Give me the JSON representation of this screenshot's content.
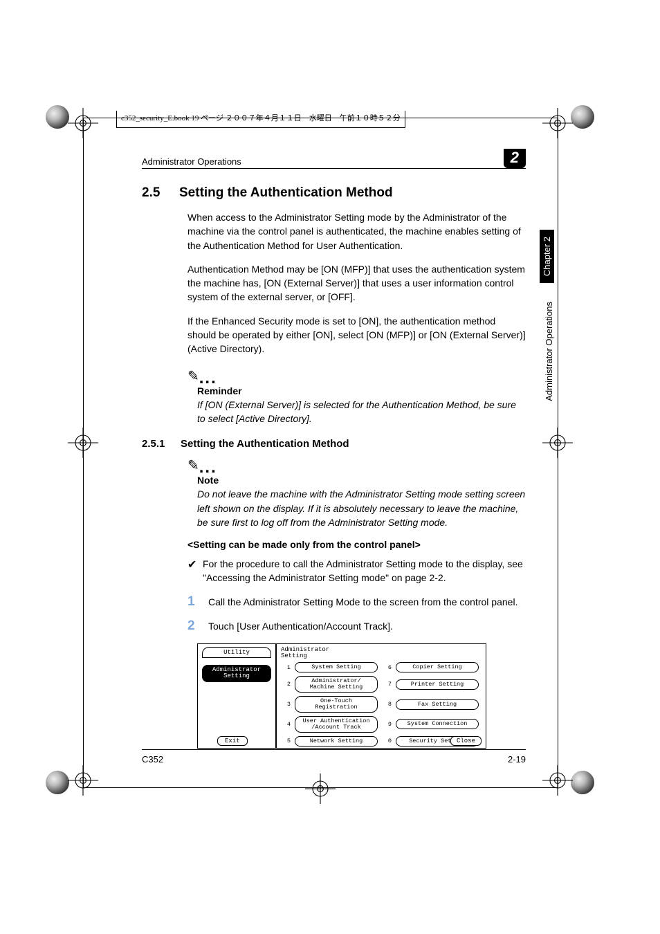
{
  "book_header": "c352_security_E.book  19 ページ  ２００７年４月１１日　水曜日　午前１０時５２分",
  "running_head": "Administrator Operations",
  "chapter_badge": "2",
  "side": {
    "chapter": "Chapter 2",
    "label": "Administrator Operations"
  },
  "section": {
    "num": "2.5",
    "title": "Setting the Authentication Method"
  },
  "paras": {
    "p1": "When access to the Administrator Setting mode by the Administrator of the machine via the control panel is authenticated, the machine enables setting of the Authentication Method for User Authentication.",
    "p2": "Authentication Method may be [ON (MFP)] that uses the authentication system the machine has, [ON (External Server)] that uses a user information control system of the external server, or [OFF].",
    "p3": "If the Enhanced Security mode is set to [ON], the authentication method should be operated by either [ON], select [ON (MFP)] or [ON (External Server)] (Active Directory)."
  },
  "reminder": {
    "label": "Reminder",
    "body": "If [ON (External Server)] is selected for the Authentication Method, be sure to select [Active Directory]."
  },
  "subsection": {
    "num": "2.5.1",
    "title": "Setting the Authentication Method"
  },
  "note": {
    "label": "Note",
    "body": "Do not leave the machine with the Administrator Setting mode setting screen left shown on the display. If it is absolutely necessary to leave the machine, be sure first to log off from the Administrator Setting mode."
  },
  "setting_head": "<Setting can be made only from the control panel>",
  "check": "For the procedure to call the Administrator Setting mode to the display, see \"Accessing the Administrator Setting mode\" on page 2-2.",
  "steps": {
    "s1": "Call the Administrator Setting Mode to the screen from the control panel.",
    "s2": "Touch [User Authentication/Account Track]."
  },
  "screenshot": {
    "pane_title_l1": "Administrator",
    "pane_title_l2": "Setting",
    "left_tab1": "Utility",
    "left_tab2_l1": "Administrator",
    "left_tab2_l2": "Setting",
    "exit": "Exit",
    "close": "Close",
    "items": [
      {
        "n": "1",
        "label": "System Setting"
      },
      {
        "n": "2",
        "label": "Administrator/\nMachine Setting"
      },
      {
        "n": "3",
        "label": "One-Touch\nRegistration"
      },
      {
        "n": "4",
        "label": "User Authentication\n/Account Track"
      },
      {
        "n": "5",
        "label": "Network Setting"
      },
      {
        "n": "6",
        "label": "Copier Setting"
      },
      {
        "n": "7",
        "label": "Printer Setting"
      },
      {
        "n": "8",
        "label": "Fax Setting"
      },
      {
        "n": "9",
        "label": "System Connection"
      },
      {
        "n": "0",
        "label": "Security Setting"
      }
    ]
  },
  "footer": {
    "left": "C352",
    "right": "2-19"
  }
}
